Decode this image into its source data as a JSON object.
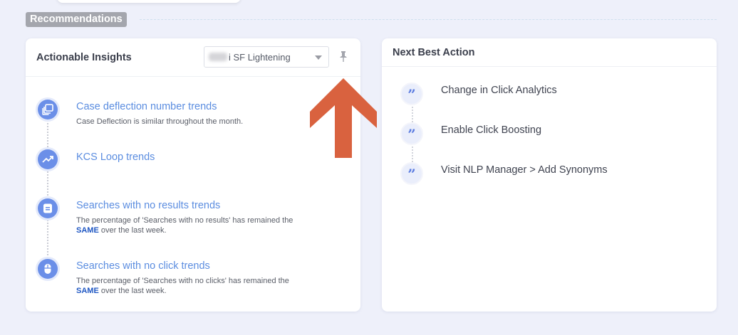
{
  "section": {
    "title": "Recommendations"
  },
  "insights": {
    "title": "Actionable Insights",
    "select_value": "i SF Lightening",
    "items": [
      {
        "title": "Case deflection number trends",
        "desc": "Case Deflection is similar throughout the month.",
        "icon": "layers-icon"
      },
      {
        "title": "KCS Loop trends",
        "desc": "",
        "icon": "trend-icon"
      },
      {
        "title": "Searches with no results trends",
        "desc_pre": "The percentage of 'Searches with no results' has remained the",
        "desc_bold": "SAME",
        "desc_post": " over the last week.",
        "icon": "list-icon"
      },
      {
        "title": "Searches with no click trends",
        "desc_pre": "The percentage of 'Searches with no clicks' has remained the",
        "desc_bold": "SAME",
        "desc_post": " over the last week.",
        "icon": "mouse-icon"
      }
    ]
  },
  "nba": {
    "title": "Next Best Action",
    "items": [
      {
        "label": "Change in Click Analytics"
      },
      {
        "label": "Enable Click Boosting"
      },
      {
        "label": "Visit NLP Manager > Add Synonyms"
      }
    ],
    "quote_glyph": "”"
  },
  "colors": {
    "accent": "#5b8de0",
    "arrow": "#d9623f",
    "badge": "#a4a6ad"
  }
}
